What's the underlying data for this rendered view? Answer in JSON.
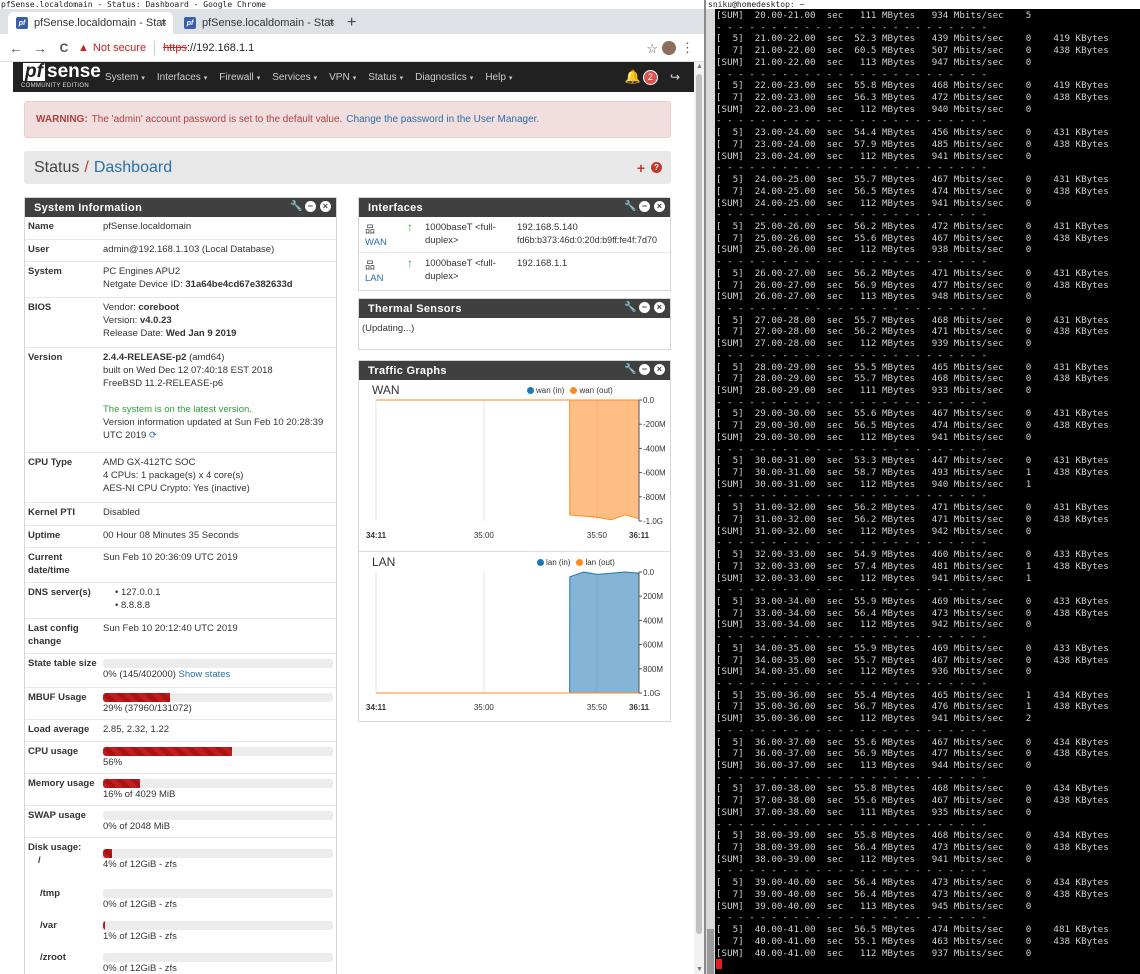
{
  "window": {
    "title": "pfSense.localdomain - Status: Dashboard - Google Chrome"
  },
  "tabs": [
    {
      "label": "pfSense.localdomain - Stat",
      "favicon": "pf"
    },
    {
      "label": "pfSense.localdomain - Stat",
      "favicon": "pf"
    }
  ],
  "tab_close": "×",
  "new_tab": "+",
  "toolbar": {
    "back": "←",
    "forward": "→",
    "reload": "C",
    "warning_icon": "▲",
    "not_secure": "Not secure",
    "url_scheme": "https",
    "url_rest": "://192.168.1.1",
    "star": "☆",
    "menu": "⋮"
  },
  "nav": {
    "logo_pf": "pf",
    "logo_sense": "sense",
    "logo_edition": "COMMUNITY EDITION",
    "caret": "▾",
    "menu": [
      "System",
      "Interfaces",
      "Firewall",
      "Services",
      "VPN",
      "Status",
      "Diagnostics",
      "Help"
    ],
    "notifications": "2",
    "bell": "🔔",
    "logout": "↪"
  },
  "alert": {
    "label": "WARNING:",
    "text": "The 'admin' account password is set to the default value.",
    "link": "Change the password in the User Manager."
  },
  "breadcrumb": {
    "section": "Status",
    "slash": "/",
    "page": "Dashboard",
    "plus": "+",
    "help": "?"
  },
  "panel_icons": {
    "wrench": "🔧",
    "minimize": "−",
    "close": "×"
  },
  "system_info": {
    "title": "System Information",
    "name": "pfSense.localdomain",
    "user": "admin@192.168.1.103 (Local Database)",
    "system_model": "PC Engines APU2",
    "device_id_label": "Netgate Device ID:",
    "device_id": "31a64be4cd67e382633d",
    "bios_vendor_label": "Vendor:",
    "bios_vendor": "coreboot",
    "bios_version_label": "Version:",
    "bios_version": "v4.0.23",
    "bios_date_label": "Release Date:",
    "bios_date": "Wed Jan 9 2019",
    "version": "2.4.4-RELEASE-p2",
    "version_arch": "(amd64)",
    "version_built": "built on Wed Dec 12 07:40:18 EST 2018",
    "version_freebsd": "FreeBSD 11.2-RELEASE-p6",
    "version_status": "The system is on the latest version.",
    "version_updated": "Version information updated at Sun Feb 10 20:28:39 UTC 2019",
    "refresh_icon": "⟳",
    "cpu_type": "AMD GX-412TC SOC",
    "cpu_count": "4 CPUs: 1 package(s) x 4 core(s)",
    "cpu_crypto": "AES-NI CPU Crypto: Yes (inactive)",
    "kernel_pti": "Disabled",
    "uptime": "00 Hour 08 Minutes 35 Seconds",
    "current_datetime": "Sun Feb 10 20:36:09 UTC 2019",
    "dns_servers": [
      "127.0.0.1",
      "8.8.8.8"
    ],
    "last_config_change": "Sun Feb 10 20:12:40 UTC 2019",
    "state_table_text": "0% (145/402000)",
    "state_table_link": "Show states",
    "state_table_fraction": 0.0004,
    "mbuf_text": "29% (37960/131072)",
    "mbuf_fraction": 0.29,
    "load_average": "2.85, 2.32, 1.22",
    "cpu_usage_text": "56%",
    "cpu_usage_fraction": 0.56,
    "memory_text": "16% of 4029 MiB",
    "memory_fraction": 0.16,
    "swap_text": "0% of 2048 MiB",
    "swap_fraction": 0,
    "disks": [
      {
        "mount": "/",
        "text": "4% of 12GiB - zfs",
        "fraction": 0.04
      },
      {
        "mount": "/tmp",
        "text": "0% of 12GiB - zfs",
        "fraction": 0
      },
      {
        "mount": "/var",
        "text": "1% of 12GiB - zfs",
        "fraction": 0.01
      },
      {
        "mount": "/zroot",
        "text": "0% of 12GiB - zfs",
        "fraction": 0
      }
    ],
    "labels": {
      "name": "Name",
      "user": "User",
      "system": "System",
      "bios": "BIOS",
      "version": "Version",
      "cpu_type": "CPU Type",
      "kernel_pti": "Kernel PTI",
      "uptime": "Uptime",
      "current_datetime": "Current date/time",
      "dns": "DNS server(s)",
      "last_config": "Last config change",
      "state_table": "State table size",
      "mbuf": "MBUF Usage",
      "load": "Load average",
      "cpu_usage": "CPU usage",
      "memory": "Memory usage",
      "swap": "SWAP usage",
      "disk": "Disk usage:"
    }
  },
  "interfaces": {
    "title": "Interfaces",
    "net_icon": "品",
    "up_icon": "↑",
    "rows": [
      {
        "name": "WAN",
        "media": "1000baseT <full-duplex>",
        "ipv4": "192.168.5.140",
        "ipv6": "fd6b:b373:46d:0:20d:b9ff:fe4f:7d70"
      },
      {
        "name": "LAN",
        "media": "1000baseT <full-duplex>",
        "ipv4": "192.168.1.1",
        "ipv6": ""
      }
    ]
  },
  "thermal": {
    "title": "Thermal Sensors",
    "status": "(Updating...)"
  },
  "traffic": {
    "title": "Traffic Graphs",
    "wan_title": "WAN",
    "lan_title": "LAN",
    "wan_legend": [
      "wan (in)",
      "wan (out)"
    ],
    "lan_legend": [
      "lan (in)",
      "lan (out)"
    ],
    "colors": {
      "in": "#1f77b4",
      "out": "#ff8a1f"
    }
  },
  "chart_data": [
    {
      "type": "area",
      "title": "WAN",
      "x_ticks": [
        "34:11",
        "35:00",
        "35:50",
        "36:11"
      ],
      "y_ticks": [
        "0.0",
        "-200M",
        "-400M",
        "-600M",
        "-800M",
        "-1.0G"
      ],
      "ylim": [
        -1.0,
        0
      ],
      "series": [
        {
          "name": "wan (in)",
          "values": [
            0,
            0,
            0,
            0,
            0,
            0,
            0,
            0,
            0,
            0,
            0,
            0,
            0,
            0,
            0,
            0,
            0,
            0,
            0,
            0
          ]
        },
        {
          "name": "wan (out)",
          "values": [
            0,
            0,
            0,
            0,
            0,
            0,
            0,
            0,
            0,
            0,
            0,
            0,
            0,
            0,
            -0.95,
            -0.96,
            -0.97,
            -0.99,
            -0.95,
            -0.98
          ]
        }
      ]
    },
    {
      "type": "area",
      "title": "LAN",
      "x_ticks": [
        "34:11",
        "35:00",
        "35:50",
        "36:11"
      ],
      "y_ticks": [
        "0.0",
        "200M",
        "400M",
        "600M",
        "800M",
        "1.0G"
      ],
      "ylim": [
        0,
        1.0
      ],
      "series": [
        {
          "name": "lan (in)",
          "values": [
            0,
            0,
            0,
            0,
            0,
            0,
            0,
            0,
            0,
            0,
            0,
            0,
            0,
            0,
            0.96,
            1.0,
            0.98,
            0.99,
            1.0,
            0.99
          ]
        },
        {
          "name": "lan (out)",
          "values": [
            0,
            0,
            0,
            0,
            0,
            0,
            0,
            0,
            0,
            0,
            0,
            0,
            0,
            0,
            0,
            0,
            0,
            0,
            0,
            0
          ]
        }
      ]
    }
  ],
  "terminal": {
    "title": "sniku@homedesktop: ~",
    "lines": [
      "[SUM]  20.00-21.00  sec   111 MBytes   934 Mbits/sec    5",
      "- - - - - - - - - - - - - - - - - - - - - - - - -",
      "[  5]  21.00-22.00  sec  52.3 MBytes   439 Mbits/sec    0    419 KBytes",
      "[  7]  21.00-22.00  sec  60.5 MBytes   507 Mbits/sec    0    438 KBytes",
      "[SUM]  21.00-22.00  sec   113 MBytes   947 Mbits/sec    0",
      "- - - - - - - - - - - - - - - - - - - - - - - - -",
      "[  5]  22.00-23.00  sec  55.8 MBytes   468 Mbits/sec    0    419 KBytes",
      "[  7]  22.00-23.00  sec  56.3 MBytes   472 Mbits/sec    0    438 KBytes",
      "[SUM]  22.00-23.00  sec   112 MBytes   940 Mbits/sec    0",
      "- - - - - - - - - - - - - - - - - - - - - - - - -",
      "[  5]  23.00-24.00  sec  54.4 MBytes   456 Mbits/sec    0    431 KBytes",
      "[  7]  23.00-24.00  sec  57.9 MBytes   485 Mbits/sec    0    438 KBytes",
      "[SUM]  23.00-24.00  sec   112 MBytes   941 Mbits/sec    0",
      "- - - - - - - - - - - - - - - - - - - - - - - - -",
      "[  5]  24.00-25.00  sec  55.7 MBytes   467 Mbits/sec    0    431 KBytes",
      "[  7]  24.00-25.00  sec  56.5 MBytes   474 Mbits/sec    0    438 KBytes",
      "[SUM]  24.00-25.00  sec   112 MBytes   941 Mbits/sec    0",
      "- - - - - - - - - - - - - - - - - - - - - - - - -",
      "[  5]  25.00-26.00  sec  56.2 MBytes   472 Mbits/sec    0    431 KBytes",
      "[  7]  25.00-26.00  sec  55.6 MBytes   467 Mbits/sec    0    438 KBytes",
      "[SUM]  25.00-26.00  sec   112 MBytes   938 Mbits/sec    0",
      "- - - - - - - - - - - - - - - - - - - - - - - - -",
      "[  5]  26.00-27.00  sec  56.2 MBytes   471 Mbits/sec    0    431 KBytes",
      "[  7]  26.00-27.00  sec  56.9 MBytes   477 Mbits/sec    0    438 KBytes",
      "[SUM]  26.00-27.00  sec   113 MBytes   948 Mbits/sec    0",
      "- - - - - - - - - - - - - - - - - - - - - - - - -",
      "[  5]  27.00-28.00  sec  55.7 MBytes   468 Mbits/sec    0    431 KBytes",
      "[  7]  27.00-28.00  sec  56.2 MBytes   471 Mbits/sec    0    438 KBytes",
      "[SUM]  27.00-28.00  sec   112 MBytes   939 Mbits/sec    0",
      "- - - - - - - - - - - - - - - - - - - - - - - - -",
      "[  5]  28.00-29.00  sec  55.5 MBytes   465 Mbits/sec    0    431 KBytes",
      "[  7]  28.00-29.00  sec  55.7 MBytes   468 Mbits/sec    0    438 KBytes",
      "[SUM]  28.00-29.00  sec   111 MBytes   933 Mbits/sec    0",
      "- - - - - - - - - - - - - - - - - - - - - - - - -",
      "[  5]  29.00-30.00  sec  55.6 MBytes   467 Mbits/sec    0    431 KBytes",
      "[  7]  29.00-30.00  sec  56.5 MBytes   474 Mbits/sec    0    438 KBytes",
      "[SUM]  29.00-30.00  sec   112 MBytes   941 Mbits/sec    0",
      "- - - - - - - - - - - - - - - - - - - - - - - - -",
      "[  5]  30.00-31.00  sec  53.3 MBytes   447 Mbits/sec    0    431 KBytes",
      "[  7]  30.00-31.00  sec  58.7 MBytes   493 Mbits/sec    1    438 KBytes",
      "[SUM]  30.00-31.00  sec   112 MBytes   940 Mbits/sec    1",
      "- - - - - - - - - - - - - - - - - - - - - - - - -",
      "[  5]  31.00-32.00  sec  56.2 MBytes   471 Mbits/sec    0    431 KBytes",
      "[  7]  31.00-32.00  sec  56.2 MBytes   471 Mbits/sec    0    438 KBytes",
      "[SUM]  31.00-32.00  sec   112 MBytes   942 Mbits/sec    0",
      "- - - - - - - - - - - - - - - - - - - - - - - - -",
      "[  5]  32.00-33.00  sec  54.9 MBytes   460 Mbits/sec    0    433 KBytes",
      "[  7]  32.00-33.00  sec  57.4 MBytes   481 Mbits/sec    1    438 KBytes",
      "[SUM]  32.00-33.00  sec   112 MBytes   941 Mbits/sec    1",
      "- - - - - - - - - - - - - - - - - - - - - - - - -",
      "[  5]  33.00-34.00  sec  55.9 MBytes   469 Mbits/sec    0    433 KBytes",
      "[  7]  33.00-34.00  sec  56.4 MBytes   473 Mbits/sec    0    438 KBytes",
      "[SUM]  33.00-34.00  sec   112 MBytes   942 Mbits/sec    0",
      "- - - - - - - - - - - - - - - - - - - - - - - - -",
      "[  5]  34.00-35.00  sec  55.9 MBytes   469 Mbits/sec    0    433 KBytes",
      "[  7]  34.00-35.00  sec  55.7 MBytes   467 Mbits/sec    0    438 KBytes",
      "[SUM]  34.00-35.00  sec   112 MBytes   936 Mbits/sec    0",
      "- - - - - - - - - - - - - - - - - - - - - - - - -",
      "[  5]  35.00-36.00  sec  55.4 MBytes   465 Mbits/sec    1    434 KBytes",
      "[  7]  35.00-36.00  sec  56.7 MBytes   476 Mbits/sec    1    438 KBytes",
      "[SUM]  35.00-36.00  sec   112 MBytes   941 Mbits/sec    2",
      "- - - - - - - - - - - - - - - - - - - - - - - - -",
      "[  5]  36.00-37.00  sec  55.6 MBytes   467 Mbits/sec    0    434 KBytes",
      "[  7]  36.00-37.00  sec  56.9 MBytes   477 Mbits/sec    0    438 KBytes",
      "[SUM]  36.00-37.00  sec   113 MBytes   944 Mbits/sec    0",
      "- - - - - - - - - - - - - - - - - - - - - - - - -",
      "[  5]  37.00-38.00  sec  55.8 MBytes   468 Mbits/sec    0    434 KBytes",
      "[  7]  37.00-38.00  sec  55.6 MBytes   467 Mbits/sec    0    438 KBytes",
      "[SUM]  37.00-38.00  sec   111 MBytes   935 Mbits/sec    0",
      "- - - - - - - - - - - - - - - - - - - - - - - - -",
      "[  5]  38.00-39.00  sec  55.8 MBytes   468 Mbits/sec    0    434 KBytes",
      "[  7]  38.00-39.00  sec  56.4 MBytes   473 Mbits/sec    0    438 KBytes",
      "[SUM]  38.00-39.00  sec   112 MBytes   941 Mbits/sec    0",
      "- - - - - - - - - - - - - - - - - - - - - - - - -",
      "[  5]  39.00-40.00  sec  56.4 MBytes   473 Mbits/sec    0    434 KBytes",
      "[  7]  39.00-40.00  sec  56.4 MBytes   473 Mbits/sec    0    438 KBytes",
      "[SUM]  39.00-40.00  sec   113 MBytes   945 Mbits/sec    0",
      "- - - - - - - - - - - - - - - - - - - - - - - - -",
      "[  5]  40.00-41.00  sec  56.5 MBytes   474 Mbits/sec    0    481 KBytes",
      "[  7]  40.00-41.00  sec  55.1 MBytes   463 Mbits/sec    0    438 KBytes",
      "[SUM]  40.00-41.00  sec   112 MBytes   937 Mbits/sec    0"
    ]
  }
}
